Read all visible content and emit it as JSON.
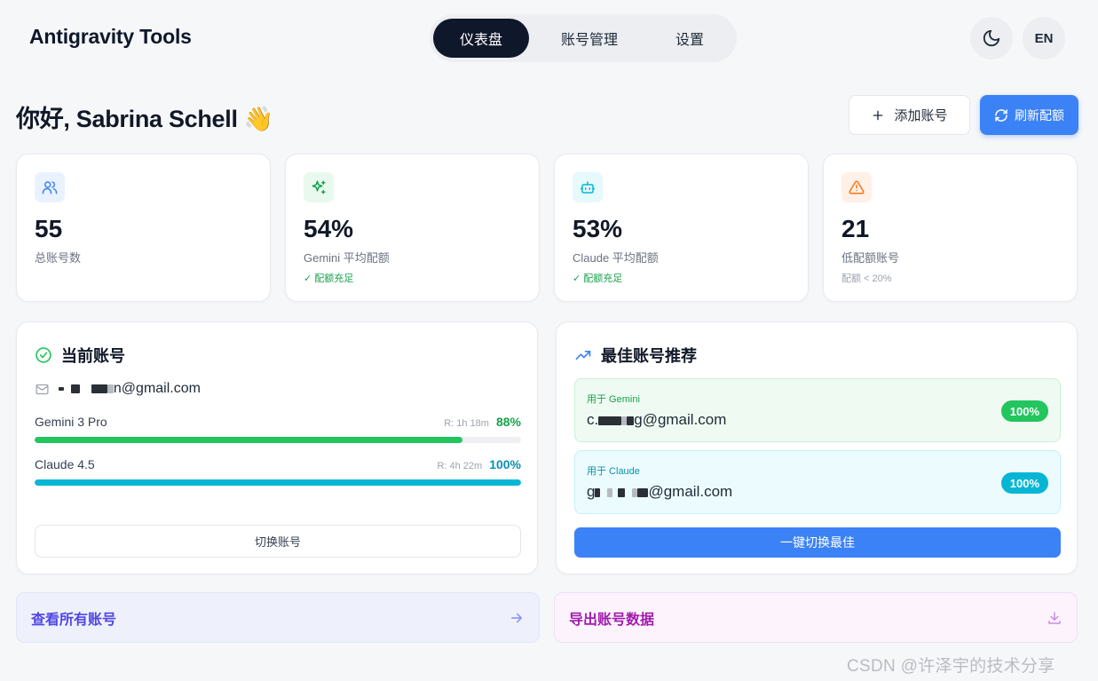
{
  "app": {
    "title": "Antigravity Tools"
  },
  "nav": {
    "tabs": [
      {
        "label": "仪表盘",
        "active": true
      },
      {
        "label": "账号管理"
      },
      {
        "label": "设置"
      }
    ]
  },
  "header": {
    "theme_icon": "moon-icon",
    "lang_label": "EN"
  },
  "greeting": {
    "text": "你好, Sabrina Schell 👋"
  },
  "actions": {
    "add_label": "添加账号",
    "refresh_label": "刷新配额"
  },
  "stats": [
    {
      "icon": "users-icon",
      "value": "55",
      "label": "总账号数",
      "note": "",
      "color": "#3b82f6"
    },
    {
      "icon": "sparkles-icon",
      "value": "54%",
      "label": "Gemini 平均配额",
      "note": "✓ 配额充足",
      "color": "#16a34a"
    },
    {
      "icon": "bot-icon",
      "value": "53%",
      "label": "Claude 平均配额",
      "note": "✓ 配额充足",
      "color": "#06b6d4"
    },
    {
      "icon": "alert-triangle-icon",
      "value": "21",
      "label": "低配额账号",
      "note": "配额 < 20%",
      "color": "#f97316"
    }
  ],
  "current": {
    "title": "当前账号",
    "email_suffix": "n@gmail.com",
    "quotas": [
      {
        "name": "Gemini 3 Pro",
        "reset": "R: 1h 18m",
        "pct": "88%",
        "value": 88,
        "color": "#22c55e",
        "text_color": "#16a34a"
      },
      {
        "name": "Claude 4.5",
        "reset": "R: 4h 22m",
        "pct": "100%",
        "value": 100,
        "color": "#06b6d4",
        "text_color": "#0891b2"
      }
    ],
    "switch_label": "切换账号"
  },
  "best": {
    "title": "最佳账号推荐",
    "gemini": {
      "label": "用于 Gemini",
      "email_prefix": "c.",
      "email_suffix": "g@gmail.com",
      "badge": "100%"
    },
    "claude": {
      "label": "用于 Claude",
      "email_prefix": "g",
      "email_suffix": "@gmail.com",
      "badge": "100%"
    },
    "switch_best_label": "一键切换最佳"
  },
  "footer": {
    "view_all": "查看所有账号",
    "export": "导出账号数据"
  },
  "watermark": "CSDN @许泽宇的技术分享"
}
